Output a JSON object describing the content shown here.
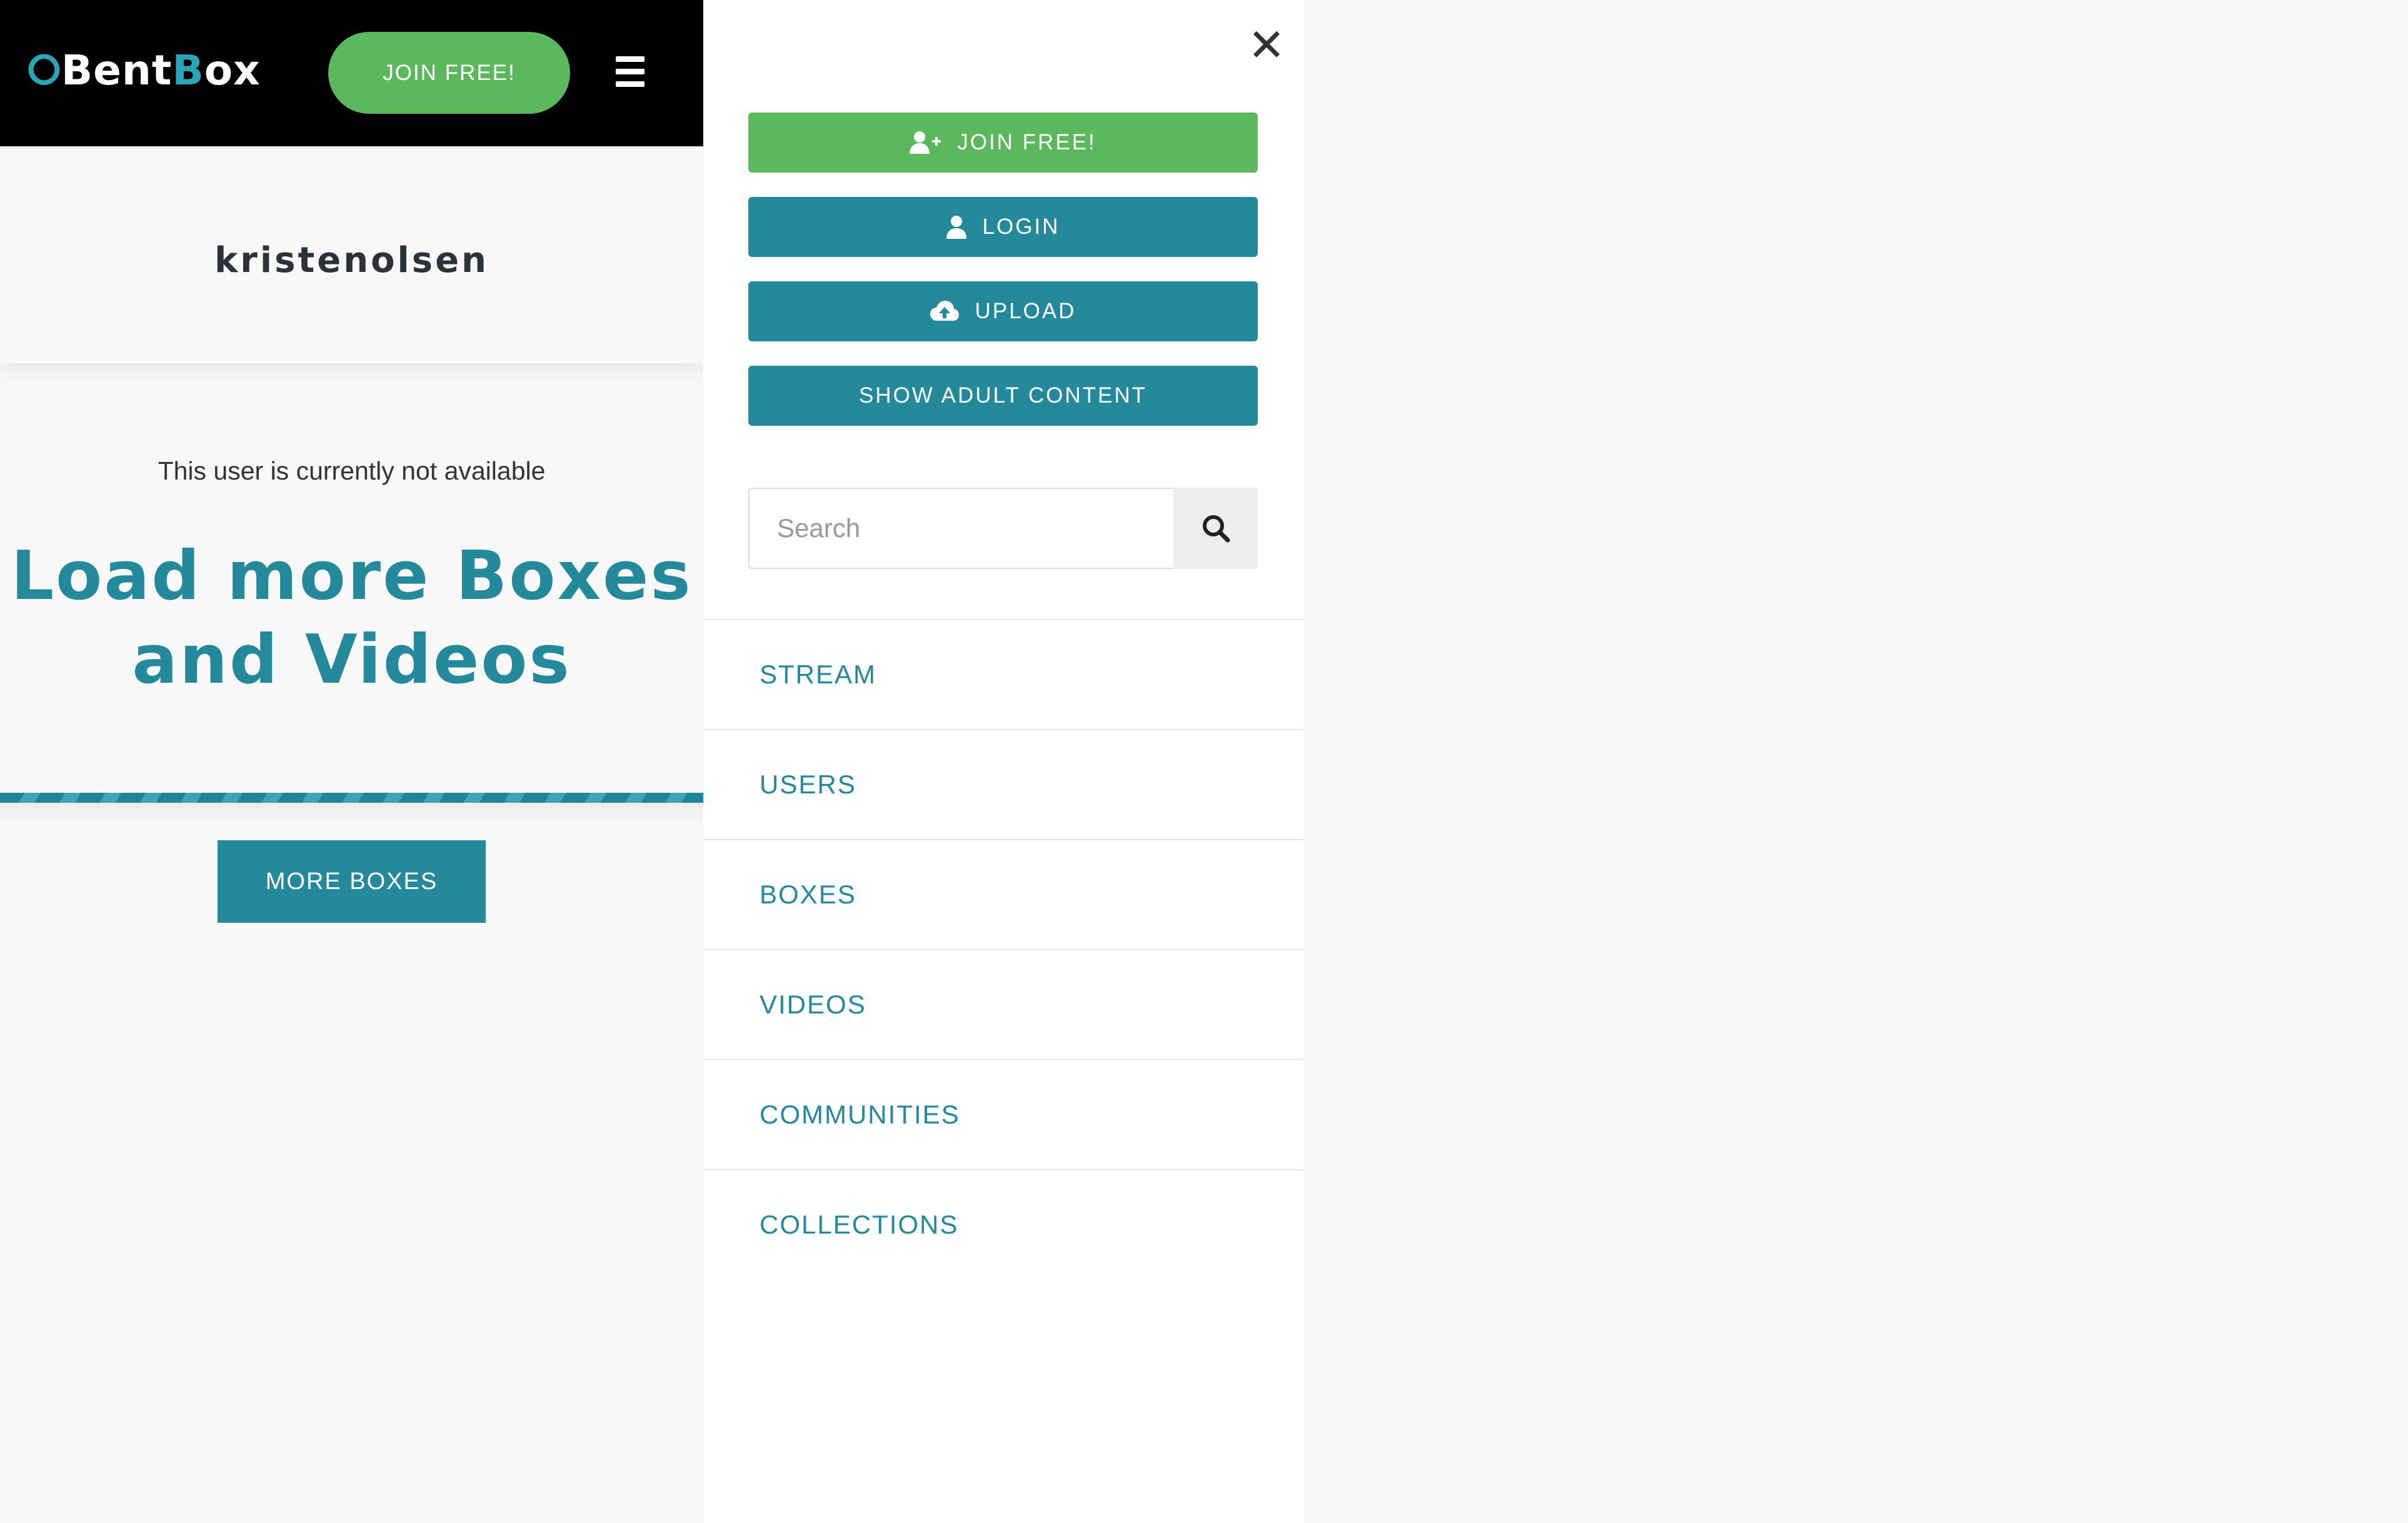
{
  "header": {
    "logo_left": "Bent",
    "logo_accent": "B",
    "logo_right": "ox",
    "join_label": "JOIN FREE!",
    "menu_icon": "hamburger-icon"
  },
  "profile": {
    "username": "kristenolsen",
    "status_text": "This user is currently not available",
    "load_more_title": "Load more Boxes and Videos",
    "more_boxes_label": "MORE BOXES"
  },
  "side_menu": {
    "close_glyph": "✕",
    "buttons": {
      "join": {
        "label": "JOIN FREE!",
        "icon": "user-plus-icon"
      },
      "login": {
        "label": "LOGIN",
        "icon": "user-icon"
      },
      "upload": {
        "label": "UPLOAD",
        "icon": "cloud-upload-icon"
      },
      "adult": {
        "label": "SHOW ADULT CONTENT"
      }
    },
    "search": {
      "placeholder": "Search",
      "value": "",
      "icon": "search-icon"
    },
    "nav": [
      "STREAM",
      "USERS",
      "BOXES",
      "VIDEOS",
      "COMMUNITIES",
      "COLLECTIONS"
    ]
  },
  "colors": {
    "brand_teal": "#23899b",
    "join_green": "#5cb85c",
    "header_black": "#000000"
  }
}
